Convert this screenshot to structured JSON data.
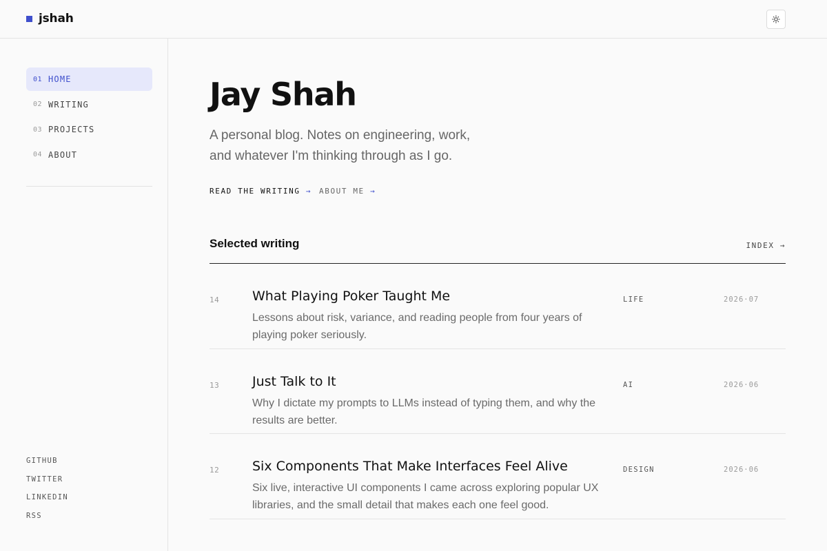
{
  "brand": {
    "name": "jshah",
    "accent": "#3f4fcc"
  },
  "header": {
    "theme_toggle_icon": "sun-icon"
  },
  "sidebar": {
    "nav": [
      {
        "num": "01",
        "label": "HOME",
        "active": true
      },
      {
        "num": "02",
        "label": "WRITING",
        "active": false
      },
      {
        "num": "03",
        "label": "PROJECTS",
        "active": false
      },
      {
        "num": "04",
        "label": "ABOUT",
        "active": false
      }
    ],
    "social": [
      {
        "label": "GITHUB"
      },
      {
        "label": "TWITTER"
      },
      {
        "label": "LINKEDIN"
      },
      {
        "label": "RSS"
      }
    ]
  },
  "hero": {
    "title": "Jay Shah",
    "subtitle": "A personal blog. Notes on engineering, work, and whatever I'm thinking through as I go.",
    "cta_primary": "READ THE WRITING",
    "cta_secondary": "ABOUT ME",
    "arrow": "→"
  },
  "writing": {
    "title": "Selected writing",
    "index_label": "INDEX →",
    "posts": [
      {
        "num": "14",
        "title": "What Playing Poker Taught Me",
        "desc": "Lessons about risk, variance, and reading people from four years of playing poker seriously.",
        "tag": "LIFE",
        "date": "2026·07"
      },
      {
        "num": "13",
        "title": "Just Talk to It",
        "desc": "Why I dictate my prompts to LLMs instead of typing them, and why the results are better.",
        "tag": "AI",
        "date": "2026·06"
      },
      {
        "num": "12",
        "title": "Six Components That Make Interfaces Feel Alive",
        "desc": "Six live, interactive UI components I came across exploring popular UX libraries, and the small detail that makes each one feel good.",
        "tag": "DESIGN",
        "date": "2026·06"
      }
    ]
  }
}
